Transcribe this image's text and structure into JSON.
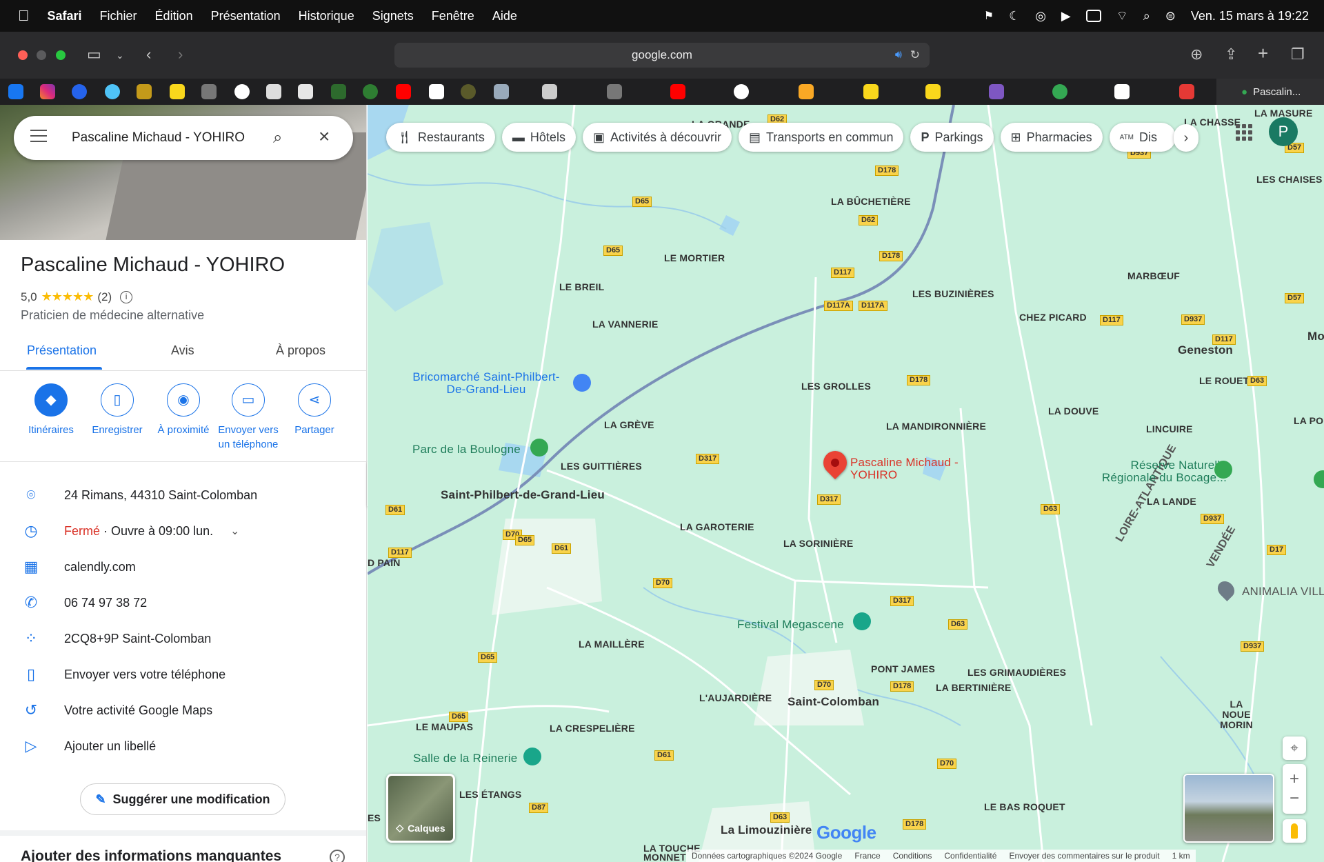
{
  "menubar": {
    "apple": "",
    "app": "Safari",
    "items": [
      "Fichier",
      "Édition",
      "Présentation",
      "Historique",
      "Signets",
      "Fenêtre",
      "Aide"
    ],
    "clock": "Ven. 15 mars à 19:22"
  },
  "browser": {
    "url": "google.com",
    "active_tab": "Pascalin..."
  },
  "search": {
    "query": "Pascaline Michaud - YOHIRO"
  },
  "place": {
    "title": "Pascaline Michaud - YOHIRO",
    "rating": "5,0",
    "stars": "★★★★★",
    "reviews": "(2)",
    "category": "Praticien de médecine alternative"
  },
  "tabs": [
    "Présentation",
    "Avis",
    "À propos"
  ],
  "actions": {
    "itineraires": "Itinéraires",
    "enregistrer": "Enregistrer",
    "proximite": "À proximité",
    "envoyer": "Envoyer vers un téléphone",
    "partager": "Partager"
  },
  "info": {
    "address": "24 Rimans, 44310 Saint-Colomban",
    "hours_status": "Fermé",
    "hours_sep": " · ",
    "hours_next": "Ouvre à 09:00 lun.",
    "website": "calendly.com",
    "phone": "06 74 97 38 72",
    "pluscode": "2CQ8+9P Saint-Colomban",
    "send_phone": "Envoyer vers votre téléphone",
    "activity": "Votre activité Google Maps",
    "label": "Ajouter un libellé"
  },
  "suggest_label": "Suggérer une modification",
  "missing_info": "Ajouter des informations manquantes",
  "chips": [
    "Restaurants",
    "Hôtels",
    "Activités à découvrir",
    "Transports en commun",
    "Parkings",
    "Pharmacies",
    "Dis"
  ],
  "avatar_letter": "P",
  "map": {
    "places": {
      "la_grande": "LA GRANDE",
      "la_chasse": "LA CHASSE",
      "la_masure": "LA MASURE",
      "les_chaises": "LES CHAISES",
      "la_buchetiere": "LA BÛCHETIÈRE",
      "le_mortier": "LE MORTIER",
      "le_breil": "LE BREIL",
      "marboeuf": "MARBŒUF",
      "les_buzinieres": "LES BUZINIÈRES",
      "chez_picard": "CHEZ PICARD",
      "la_vannerie": "LA VANNERIE",
      "geneston": "Geneston",
      "mo": "Mo",
      "le_rouet": "LE ROUET",
      "les_grolles": "LES GROLLES",
      "la_douve": "LA DOUVE",
      "la_pon": "LA PON",
      "la_greve": "LA GRÈVE",
      "la_mandironniere": "LA MANDIRONNIÈRE",
      "lincuire": "LINCUIRE",
      "les_guittieres": "LES GUITTIÈRES",
      "saint_philbert": "Saint-Philbert-de-Grand-Lieu",
      "la_lande": "LA LANDE",
      "la_garoterie": "LA GAROTERIE",
      "la_soriniere": "LA SORINIÈRE",
      "d_pain": "D PAIN",
      "la_maillere": "LA MAILLÈRE",
      "pont_james": "PONT JAMES",
      "les_grimaudieres": "LES GRIMAUDIÈRES",
      "la_bertiniere": "LA BERTINIÈRE",
      "laujardiere": "L'AUJARDIÈRE",
      "saint_colomban": "Saint-Colomban",
      "la_noue_morin": "LA NOUE MORIN",
      "le_maupas": "LE MAUPAS",
      "la_crespeliere": "LA CRESPELIÈRE",
      "les_etangs": "LES ÉTANGS",
      "le_bas_roquet": "LE BAS ROQUET",
      "la_limouziniere": "La Limouzinière",
      "la_touche_monnet": "LA TOUCHE MONNET",
      "es": "ES",
      "loire_atlantique": "LOIRE-ATLANTIQUE",
      "vendee": "VENDÉE",
      "animalia": "ANIMALIA VILL"
    },
    "pois": {
      "bricomarche": "Bricomarché Saint-Philbert-De-Grand-Lieu",
      "parc_boulogne": "Parc de la Boulogne",
      "reserve": "Réserve Naturelle Régionale du Bocage...",
      "festival": "Festival Megascene",
      "salle_reinerie": "Salle de la Reinerie",
      "target": "Pascaline Michaud - YOHIRO"
    },
    "roads": [
      "D62",
      "D178",
      "D65",
      "D57",
      "D937",
      "D117",
      "D117A",
      "D61",
      "D70",
      "D317",
      "D63",
      "D17",
      "D87",
      "D65",
      "D178"
    ],
    "layers_label": "Calques",
    "google_logo": "Google",
    "attribution": [
      "Données cartographiques ©2024 Google",
      "France",
      "Conditions",
      "Confidentialité",
      "Envoyer des commentaires sur le produit",
      "1 km"
    ]
  },
  "colors": {
    "accent": "#1a73e8",
    "closed": "#d93025",
    "map_bg": "#c9f0dd",
    "road": "#f9d34b"
  }
}
